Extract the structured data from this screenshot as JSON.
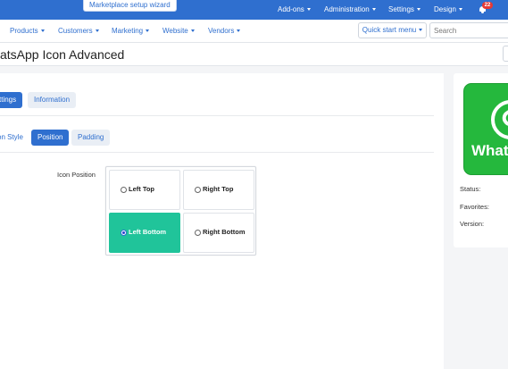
{
  "topbar": {
    "wizard_label": "Marketplace setup wizard",
    "menus": [
      {
        "label": "Add-ons"
      },
      {
        "label": "Administration"
      },
      {
        "label": "Settings"
      },
      {
        "label": "Design"
      }
    ],
    "notification_count": "22"
  },
  "nav": {
    "items": [
      {
        "label": "Products"
      },
      {
        "label": "Customers"
      },
      {
        "label": "Marketing"
      },
      {
        "label": "Website"
      },
      {
        "label": "Vendors"
      }
    ],
    "quick_start_label": "Quick start menu",
    "search_placeholder": "Search"
  },
  "page": {
    "title": "atsApp Icon Advanced"
  },
  "tabs": {
    "primary": [
      {
        "label": "ttings",
        "active": true
      },
      {
        "label": "Information",
        "active": false
      }
    ],
    "secondary": [
      {
        "label": "on Style",
        "active": false
      },
      {
        "label": "Position",
        "active": true
      },
      {
        "label": "Padding",
        "active": false
      }
    ]
  },
  "icon_position": {
    "label": "Icon Position",
    "options": [
      {
        "label": "Left Top",
        "selected": false
      },
      {
        "label": "Right Top",
        "selected": false
      },
      {
        "label": "Left Bottom",
        "selected": true
      },
      {
        "label": "Right Bottom",
        "selected": false
      }
    ]
  },
  "sidebar": {
    "logo_text": "What",
    "status_label": "Status:",
    "favorites_label": "Favorites:",
    "version_label": "Version:"
  },
  "colors": {
    "brand_blue": "#2f6fcf",
    "selected_green": "#20c49a",
    "whatsapp_green": "#25b83d",
    "badge_red": "#e53935"
  }
}
